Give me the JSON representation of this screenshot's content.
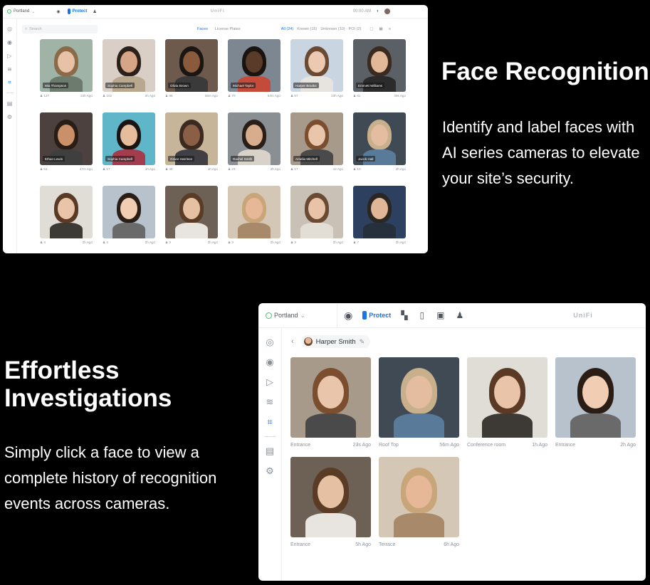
{
  "sections": {
    "face_recognition": {
      "title": "Face Recognition",
      "description": "Identify and label faces with AI series cameras to elevate your site’s security."
    },
    "investigations": {
      "title": "Effortless Investigations",
      "description": "Simply click a face to view a complete history of recognition events across cameras."
    }
  },
  "window1": {
    "site": "Portland",
    "app": "Protect",
    "brand": "UniFi",
    "clock": "00:00 AM",
    "search_placeholder": "Search",
    "tabs": [
      "Faces",
      "License Plates"
    ],
    "filters": [
      "All (24)",
      "Known (16)",
      "Unknown (10)",
      "POI (2)"
    ],
    "faces": [
      {
        "name": "Mia Thompson",
        "count": "127",
        "time": "23h Ago"
      },
      {
        "name": "Sophia Campbell",
        "count": "102",
        "time": "2h Ago"
      },
      {
        "name": "Olivia Brown",
        "count": "95",
        "time": "56m Ago"
      },
      {
        "name": "Michael Taylor",
        "count": "70",
        "time": "54m Ago"
      },
      {
        "name": "Harper Brooks",
        "count": "57",
        "time": "23h Ago"
      },
      {
        "name": "Emmett Williams",
        "count": "61",
        "time": "49s Ago"
      },
      {
        "name": "Ethan Lewis",
        "count": "61",
        "time": "47m Ago"
      },
      {
        "name": "Sophia Campbell",
        "count": "17",
        "time": "1h Ago"
      },
      {
        "name": "Grace Harrison",
        "count": "48",
        "time": "1h Ago"
      },
      {
        "name": "Rachel Smith",
        "count": "23",
        "time": "2h Ago"
      },
      {
        "name": "Amelia Mitchell",
        "count": "17",
        "time": "12 Ago"
      },
      {
        "name": "Jacob Hall",
        "count": "10",
        "time": "2h Ago"
      },
      {
        "name": "",
        "count": "4",
        "time": "2h Ago"
      },
      {
        "name": "",
        "count": "4",
        "time": "2h Ago"
      },
      {
        "name": "",
        "count": "3",
        "time": "2h Ago"
      },
      {
        "name": "",
        "count": "3",
        "time": "2h Ago"
      },
      {
        "name": "",
        "count": "3",
        "time": "2h Ago"
      },
      {
        "name": "",
        "count": "7",
        "time": "2h Ago"
      }
    ]
  },
  "window2": {
    "site": "Portland",
    "app": "Protect",
    "brand": "UniFi",
    "person": "Harper Smith",
    "events": [
      {
        "camera": "Entrance",
        "time": "23s Ago"
      },
      {
        "camera": "Roof Top",
        "time": "56m Ago"
      },
      {
        "camera": "Conference room",
        "time": "1h Ago"
      },
      {
        "camera": "Entrance",
        "time": "2h Ago"
      },
      {
        "camera": "Entrance",
        "time": "5h Ago"
      },
      {
        "camera": "Terrace",
        "time": "6h Ago"
      }
    ]
  },
  "colors": {
    "accent": "#1a73e8",
    "online": "#38cc65",
    "background": "#000000"
  }
}
